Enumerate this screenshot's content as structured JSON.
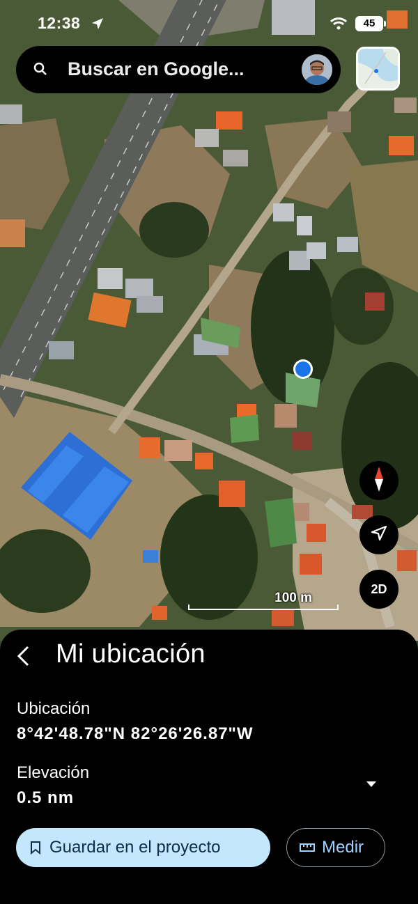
{
  "status_bar": {
    "time": "12:38",
    "battery": "45"
  },
  "search": {
    "placeholder": "Buscar en Google..."
  },
  "map": {
    "scale_label": "100 m",
    "view_mode_label": "2D"
  },
  "panel": {
    "title": "Mi ubicación",
    "location_label": "Ubicación",
    "location_value": "8°42'48.78\"N 82°26'26.87\"W",
    "elevation_label": "Elevación",
    "elevation_value": "0.5 nm",
    "save_button": "Guardar en el proyecto",
    "measure_button": "Medir"
  },
  "colors": {
    "accent_light": "#c3e7fd",
    "accent_text": "#9fd3ff",
    "location_dot": "#1a73e8",
    "sheet_bg": "#000000"
  },
  "icons": [
    "location-arrow-icon",
    "wifi-icon",
    "search-icon",
    "compass-icon",
    "navigate-icon",
    "back-chevron-icon",
    "dropdown-icon",
    "bookmark-icon",
    "ruler-icon"
  ]
}
